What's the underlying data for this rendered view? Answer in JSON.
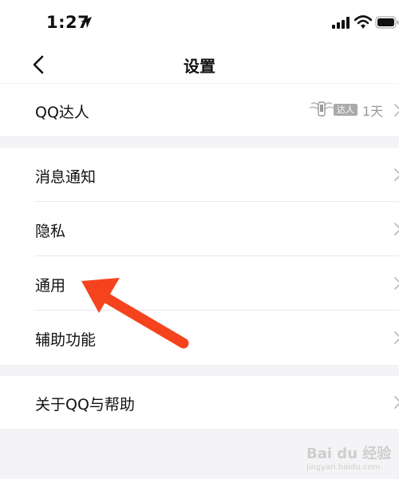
{
  "status_bar": {
    "time": "1:27",
    "location_icon": "location-arrow-icon",
    "signal_icon": "cellular-signal-icon",
    "wifi_icon": "wifi-icon",
    "battery_icon": "battery-icon"
  },
  "nav": {
    "title": "设置",
    "back_icon": "chevron-left-icon"
  },
  "sections": [
    {
      "items": [
        {
          "label": "QQ达人",
          "badge_text": "达人",
          "value": "1天",
          "badge_icon": "qq-daren-badge-icon"
        }
      ]
    },
    {
      "items": [
        {
          "label": "消息通知"
        },
        {
          "label": "隐私"
        },
        {
          "label": "通用"
        },
        {
          "label": "辅助功能"
        }
      ]
    },
    {
      "items": [
        {
          "label": "关于QQ与帮助"
        }
      ]
    }
  ],
  "annotation": {
    "icon": "red-arrow-annotation-icon",
    "color": "#f5431d"
  },
  "watermark": {
    "text": "Bai du 经验",
    "sub": "jingyan.baidu.com"
  },
  "colors": {
    "background": "#f4f4f6",
    "card": "#ffffff",
    "divider": "#e8e8ec",
    "secondary_text": "#999999"
  }
}
